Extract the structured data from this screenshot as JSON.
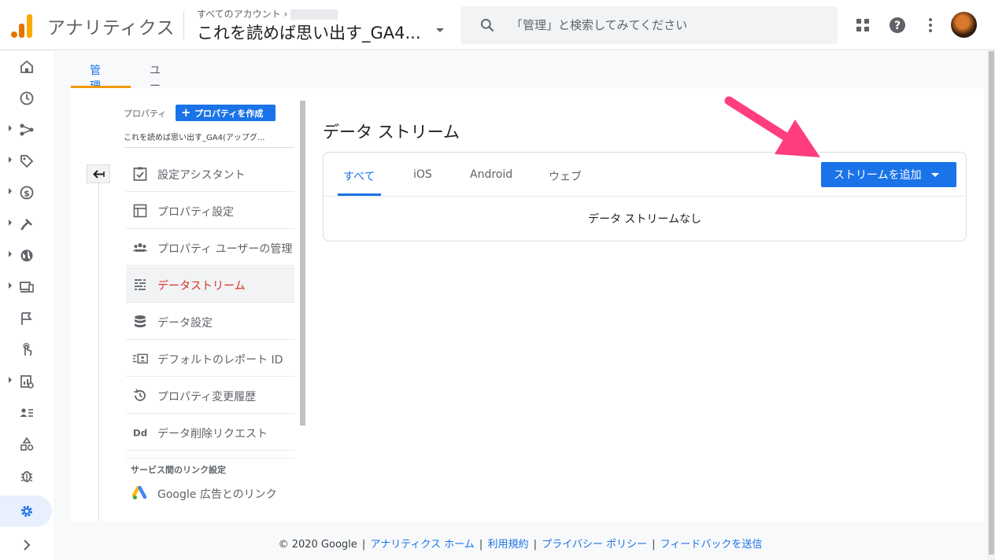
{
  "header": {
    "brand": "アナリティクス",
    "breadcrumb": "すべてのアカウント ›",
    "account_name": "これを読めば思い出す_GA4...",
    "search_placeholder": "「管理」と検索してみてください"
  },
  "main_tabs": [
    {
      "label": "管理",
      "active": true
    },
    {
      "label": "ユーザー",
      "active": false
    }
  ],
  "property": {
    "label": "プロパティ",
    "create_button": "プロパティを作成",
    "name": "これを読めば思い出す_GA4(アップグ..."
  },
  "menu": [
    {
      "label": "設定アシスタント",
      "icon": "checklist-icon"
    },
    {
      "label": "プロパティ設定",
      "icon": "window-icon"
    },
    {
      "label": "プロパティ ユーザーの管理",
      "icon": "people-icon"
    },
    {
      "label": "データストリーム",
      "icon": "streams-icon",
      "active": true
    },
    {
      "label": "データ設定",
      "icon": "database-icon"
    },
    {
      "label": "デフォルトのレポート ID",
      "icon": "report-id-icon"
    },
    {
      "label": "プロパティ変更履歴",
      "icon": "history-icon"
    },
    {
      "label": "データ削除リクエスト",
      "icon": "dd-icon"
    }
  ],
  "link_section": {
    "heading": "サービス間のリンク設定",
    "items": [
      {
        "label": "Google 広告とのリンク",
        "icon": "google-ads-icon"
      }
    ]
  },
  "streams": {
    "title": "データ ストリーム",
    "tabs": [
      {
        "label": "すべて",
        "active": true
      },
      {
        "label": "iOS"
      },
      {
        "label": "Android"
      },
      {
        "label": "ウェブ"
      }
    ],
    "add_button": "ストリームを追加",
    "empty_text": "データ ストリームなし"
  },
  "footer": {
    "copyright": "© 2020 Google",
    "links": [
      "アナリティクス ホーム",
      "利用規約",
      "プライバシー ポリシー",
      "フィードバックを送信"
    ]
  },
  "colors": {
    "accent_blue": "#1a73e8",
    "active_red": "#d93025",
    "tab_orange": "#f29900",
    "annotation_pink": "#ff3d7f"
  }
}
